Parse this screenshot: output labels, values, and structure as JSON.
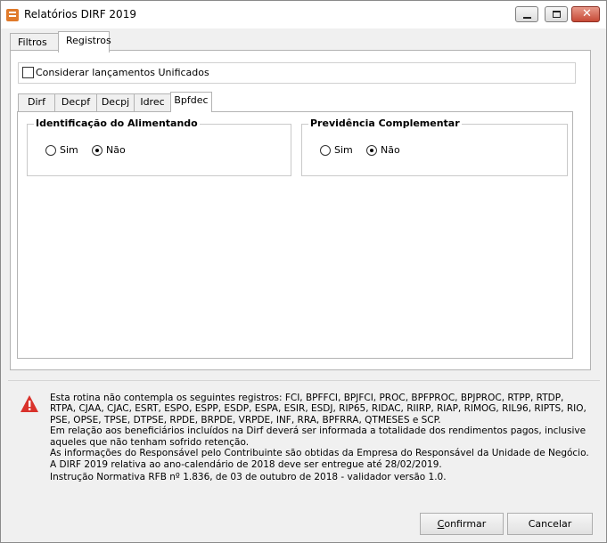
{
  "window": {
    "title": "Relatórios DIRF 2019",
    "icon": "app-icon",
    "controls": [
      "minimize-icon",
      "maximize-icon",
      "close-icon"
    ]
  },
  "tabs": [
    {
      "label": "Filtros",
      "active": false
    },
    {
      "label": "Registros",
      "active": true
    }
  ],
  "registros": {
    "unificados_label": "Considerar lançamentos Unificados",
    "unificados_checked": false,
    "subtabs": [
      {
        "label": "Dirf",
        "active": false
      },
      {
        "label": "Decpf",
        "active": false
      },
      {
        "label": "Decpj",
        "active": false
      },
      {
        "label": "Idrec",
        "active": false
      },
      {
        "label": "Bpfdec",
        "active": true
      }
    ],
    "groups": [
      {
        "title": "Identificação do Alimentando",
        "options": [
          {
            "label": "Sim",
            "checked": false
          },
          {
            "label": "Não",
            "checked": true
          }
        ]
      },
      {
        "title": "Previdência Complementar",
        "options": [
          {
            "label": "Sim",
            "checked": false
          },
          {
            "label": "Não",
            "checked": true
          }
        ]
      }
    ]
  },
  "info": {
    "icon": "warning-icon",
    "warning_color": "#d9322b",
    "lines": [
      "Esta rotina não contempla os seguintes registros: FCI, BPFFCI, BPJFCI, PROC, BPFPROC, BPJPROC, RTPP, RTDP, RTPA, CJAA, CJAC, ESRT, ESPO, ESPP, ESDP, ESPA, ESIR, ESDJ, RIP65, RIDAC, RIIRP, RIAP, RIMOG, RIL96, RIPTS, RIO, PSE, OPSE, TPSE, DTPSE, RPDE, BRPDE, VRPDE, INF, RRA, BPFRRA, QTMESES e SCP.",
      "Em relação aos beneficiários incluídos na Dirf deverá ser informada a totalidade dos rendimentos pagos, inclusive aqueles que não tenham sofrido retenção.",
      "As informações do Responsável pelo Contribuinte são obtidas da Empresa do Responsável da Unidade de Negócio.",
      "A DIRF 2019 relativa ao ano-calendário de 2018 deve ser entregue até 28/02/2019.",
      "Instrução Normativa RFB nº 1.836, de 03 de outubro de 2018 - validador versão 1.0."
    ]
  },
  "buttons": {
    "confirmar": {
      "mnemonic": "C",
      "rest": "onfirmar"
    },
    "cancelar": "Cancelar"
  }
}
